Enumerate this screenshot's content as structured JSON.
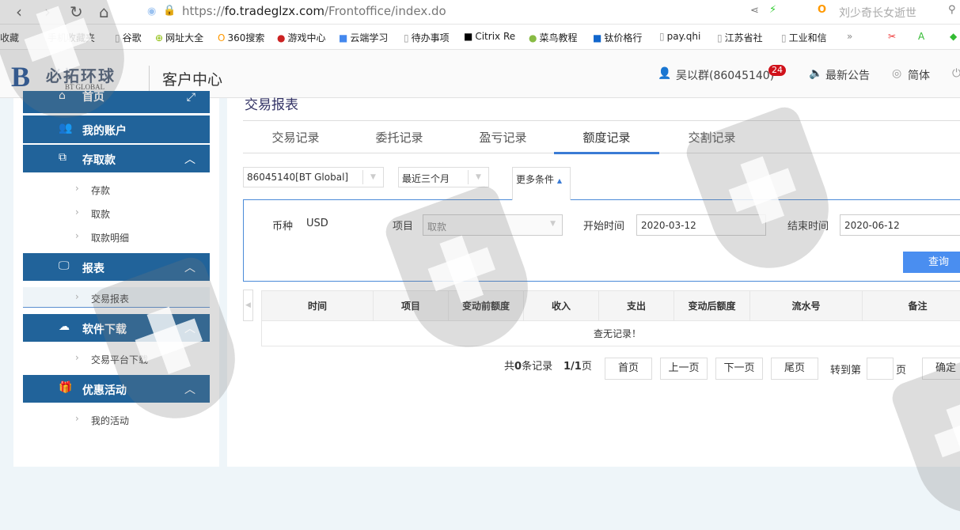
{
  "browser": {
    "url_prefix": "https://",
    "url_domain": "fo.tradeglzx.com",
    "url_path": "/Frontoffice/index.do",
    "search_text": "刘少奇长女逝世",
    "bookmarks": [
      "收藏",
      "手机收藏夹",
      "谷歌",
      "网址大全",
      "360搜索",
      "游戏中心",
      "云端学习",
      "待办事项",
      "Citrix Re",
      "菜鸟教程",
      "钛价格行",
      "pay.qhi",
      "江苏省社",
      "工业和信"
    ],
    "more": "»"
  },
  "header": {
    "logo_cn": "必拓环球",
    "logo_en": "BT GLOBAL",
    "logo_letter": "B",
    "title": "客户中心",
    "user": "吴以群(86045140)",
    "badge": "24",
    "notice": "最新公告",
    "lang": "简体"
  },
  "sidebar": {
    "home": "首页",
    "account": "我的账户",
    "funds": "存取款",
    "funds_items": [
      "存款",
      "取款",
      "取款明细"
    ],
    "reports": "报表",
    "reports_items": [
      "交易报表"
    ],
    "download": "软件下载",
    "download_items": [
      "交易平台下载"
    ],
    "promo": "优惠活动",
    "promo_items": [
      "我的活动"
    ]
  },
  "main": {
    "title": "交易报表",
    "tabs": [
      "交易记录",
      "委托记录",
      "盈亏记录",
      "额度记录",
      "交割记录"
    ],
    "account_select": "86045140[BT Global]",
    "period_select": "最近三个月",
    "more_conditions": "更多条件",
    "currency_label": "币种",
    "currency": "USD",
    "item_label": "项目",
    "item_value": "取款",
    "start_label": "开始时间",
    "start": "2020-03-12",
    "end_label": "结束时间",
    "end": "2020-06-12",
    "query": "查询",
    "columns": [
      "时间",
      "项目",
      "变动前额度",
      "收入",
      "支出",
      "变动后额度",
      "流水号",
      "备注"
    ],
    "empty": "查无记录！",
    "pager": {
      "total_pre": "共",
      "total": "0",
      "total_post": "条记录",
      "page": "1/1",
      "page_post": "页",
      "first": "首页",
      "prev": "上一页",
      "next": "下一页",
      "last": "尾页",
      "goto": "转到第",
      "goto_post": "页",
      "confirm": "确定"
    }
  }
}
